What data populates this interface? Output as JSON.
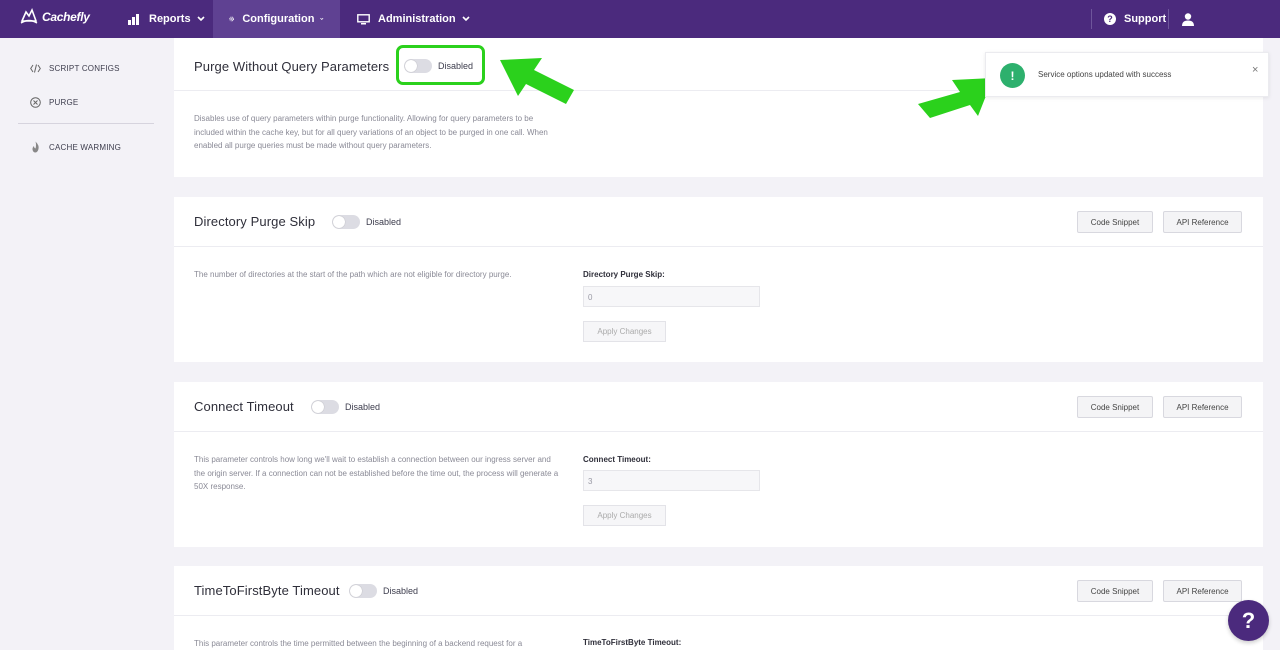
{
  "brand": {
    "logo_text": "Cachefly"
  },
  "nav": {
    "reports": "Reports",
    "configuration": "Configuration",
    "administration": "Administration",
    "support": "Support"
  },
  "sidebar": {
    "items": [
      {
        "label": "SCRIPT CONFIGS",
        "icon": "code-icon"
      },
      {
        "label": "PURGE",
        "icon": "circle-x-icon"
      },
      {
        "label": "CACHE WARMING",
        "icon": "flame-icon"
      }
    ]
  },
  "cards": [
    {
      "title": "Purge Without Query Parameters",
      "toggle_state": "Disabled",
      "description": "Disables use of query parameters within purge functionality. Allowing for query parameters to be included within the cache key, but for all query variations of an object to be purged in one call. When enabled all purge queries must be made without query parameters."
    },
    {
      "title": "Directory Purge Skip",
      "toggle_state": "Disabled",
      "code_snippet": "Code Snippet",
      "api_reference": "API Reference",
      "description": "The number of directories at the start of the path which are not eligible for directory purge.",
      "field_label": "Directory Purge Skip:",
      "field_value": "0",
      "apply": "Apply Changes"
    },
    {
      "title": "Connect Timeout",
      "toggle_state": "Disabled",
      "code_snippet": "Code Snippet",
      "api_reference": "API Reference",
      "description": "This parameter controls how long we'll wait to establish a connection between our ingress server and the origin server. If a connection can not be established before the time out, the process will generate a 50X response.",
      "field_label": "Connect Timeout:",
      "field_value": "3",
      "apply": "Apply Changes"
    },
    {
      "title": "TimeToFirstByte Timeout",
      "toggle_state": "Disabled",
      "code_snippet": "Code Snippet",
      "api_reference": "API Reference",
      "description": "This parameter controls the time permitted between the beginning of a backend request for a",
      "field_label": "TimeToFirstByte Timeout:"
    }
  ],
  "toast": {
    "message": "Service options updated with success",
    "icon": "!",
    "close": "×"
  },
  "help": {
    "label": "?"
  },
  "colors": {
    "nav_bg": "#4b2a7d",
    "nav_active": "#5f4192",
    "highlight": "#2bd11c",
    "success": "#2db06d"
  }
}
